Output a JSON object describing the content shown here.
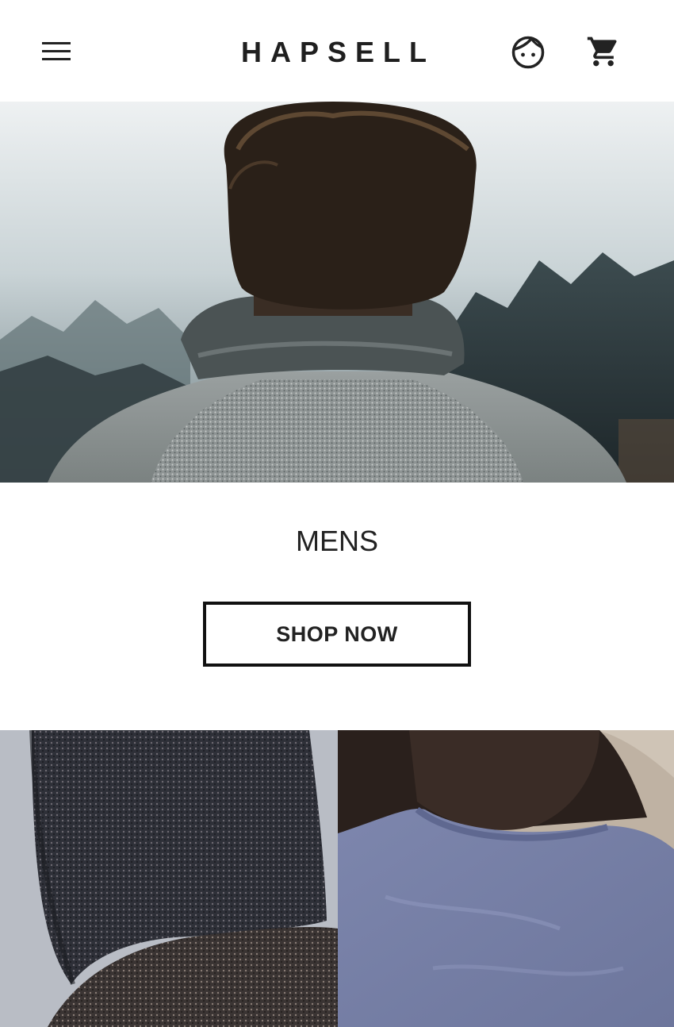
{
  "header": {
    "brand": "HAPSELL",
    "menu_icon": "hamburger-menu-icon",
    "account_icon": "face-account-icon",
    "cart_icon": "shopping-cart-icon"
  },
  "hero": {
    "image": "man-in-grey-knit-sweater-from-behind"
  },
  "category": {
    "title": "MENS",
    "cta_label": "SHOP NOW"
  },
  "tiles": [
    {
      "image": "dark-knit-hoodie"
    },
    {
      "image": "blue-tshirt-back"
    }
  ],
  "colors": {
    "text": "#222222",
    "border": "#111111",
    "background": "#ffffff"
  }
}
